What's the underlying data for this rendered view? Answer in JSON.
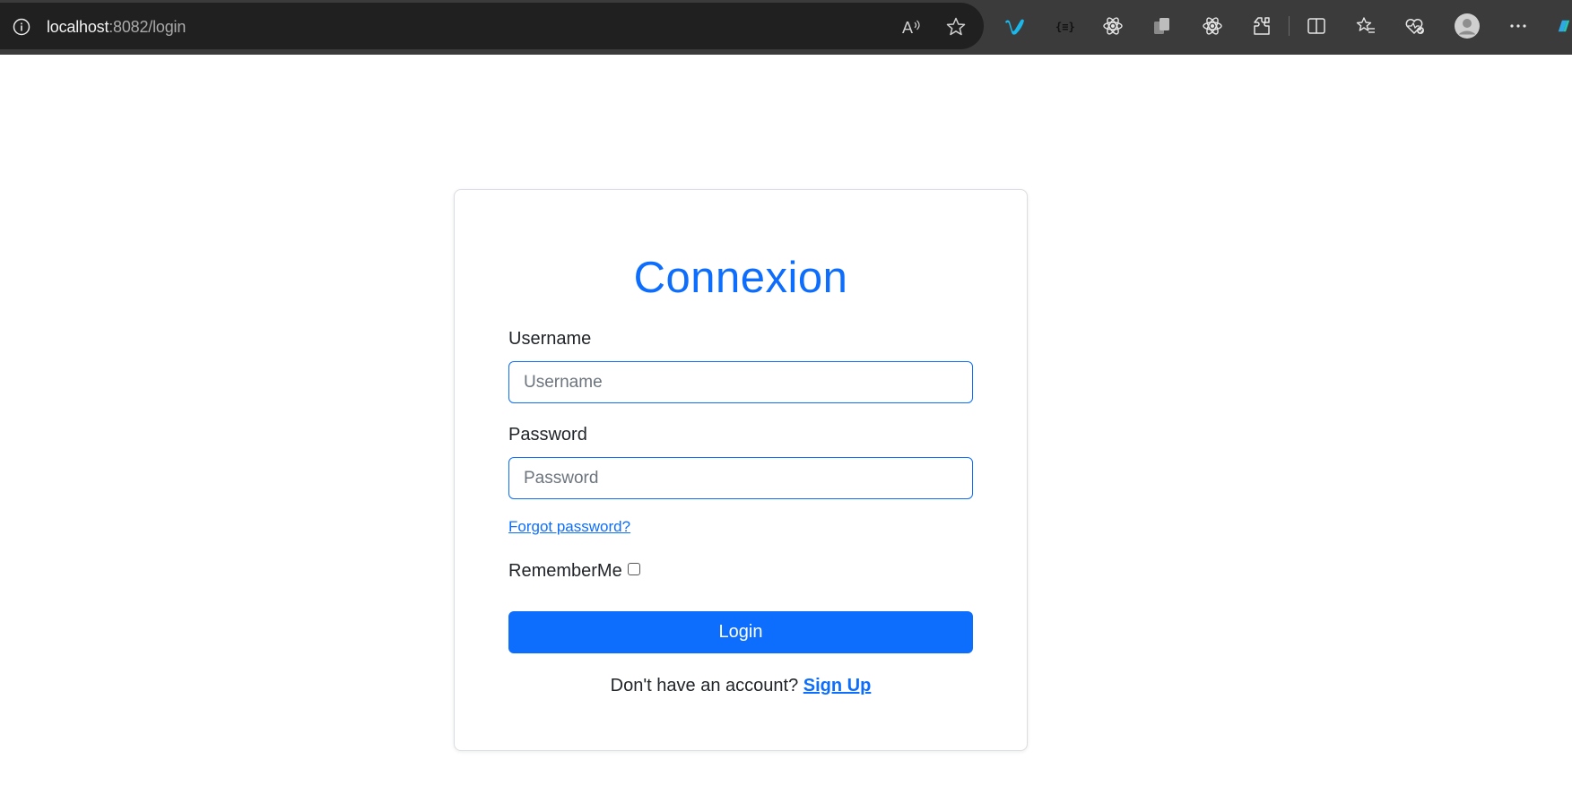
{
  "browser": {
    "url_host": "localhost",
    "url_rest": ":8082/login",
    "toolbar_icons": [
      "info-icon",
      "read-aloud-icon",
      "favorite-star-icon",
      "vimeo-icon",
      "json-viewer-icon",
      "react-devtools-icon",
      "copy-tabs-icon",
      "react-icon",
      "extensions-icon",
      "split-screen-icon",
      "favorites-icon",
      "browser-essentials-icon",
      "profile-avatar-icon",
      "more-menu-icon",
      "copilot-icon"
    ]
  },
  "login": {
    "title": "Connexion",
    "username_label": "Username",
    "username_placeholder": "Username",
    "username_value": "",
    "password_label": "Password",
    "password_placeholder": "Password",
    "password_value": "",
    "forgot_link": "Forgot password?",
    "remember_label": "RememberMe",
    "remember_checked": false,
    "login_button": "Login",
    "signup_prompt": "Don't have an account?",
    "signup_link": "Sign Up"
  },
  "colors": {
    "accent": "#0d6efd",
    "chrome_bg": "#3b3b3b",
    "address_bg": "#202020"
  }
}
